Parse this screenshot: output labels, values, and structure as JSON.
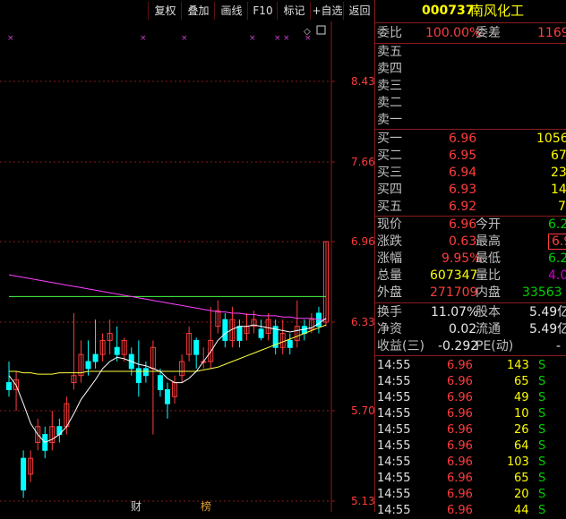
{
  "toolbar": {
    "buttons": [
      "复权",
      "叠加",
      "画线",
      "F10",
      "标记",
      "+自选",
      "返回"
    ]
  },
  "colors": {
    "up": "#ff3c3c",
    "down": "#00ffff",
    "ma_white": "#ffffff",
    "ma_yellow": "#ffff40",
    "ma_magenta": "#ff40ff",
    "ma_green": "#40ff40",
    "grid": "#8a1c1c",
    "price_label": "#ff3c3c"
  },
  "stock": {
    "code": "000737",
    "name": "南风化工"
  },
  "order_book": {
    "weibi_label": "委比",
    "weibi_value": "100.00%",
    "weicha_label": "委差",
    "weicha_value": "1169",
    "sell": [
      {
        "label": "卖五",
        "price": "",
        "vol": ""
      },
      {
        "label": "卖四",
        "price": "",
        "vol": ""
      },
      {
        "label": "卖三",
        "price": "",
        "vol": ""
      },
      {
        "label": "卖二",
        "price": "",
        "vol": ""
      },
      {
        "label": "卖一",
        "price": "",
        "vol": ""
      }
    ],
    "buy": [
      {
        "label": "买一",
        "price": "6.96",
        "vol": "1056"
      },
      {
        "label": "买二",
        "price": "6.95",
        "vol": "67"
      },
      {
        "label": "买三",
        "price": "6.94",
        "vol": "23"
      },
      {
        "label": "买四",
        "price": "6.93",
        "vol": "14"
      },
      {
        "label": "买五",
        "price": "6.92",
        "vol": "7"
      }
    ]
  },
  "quote": [
    {
      "l1": "现价",
      "v1": "6.96",
      "c1": "red",
      "l2": "今开",
      "v2": "6.2",
      "c2": "green",
      "box": false
    },
    {
      "l1": "涨跌",
      "v1": "0.63",
      "c1": "red",
      "l2": "最高",
      "v2": "6.9",
      "c2": "red",
      "box": true
    },
    {
      "l1": "涨幅",
      "v1": "9.95%",
      "c1": "red",
      "l2": "最低",
      "v2": "6.2",
      "c2": "green",
      "box": false
    },
    {
      "l1": "总量",
      "v1": "607347",
      "c1": "yellow",
      "l2": "量比",
      "v2": "4.0",
      "c2": "purple",
      "box": false
    },
    {
      "l1": "外盘",
      "v1": "271709",
      "c1": "red",
      "l2": "内盘",
      "v2": "33563",
      "c2": "green",
      "box": false
    }
  ],
  "stats": [
    {
      "l1": "换手",
      "v1": "11.07%",
      "l2": "股本",
      "v2": "5.49亿"
    },
    {
      "l1": "净资",
      "v1": "0.02",
      "l2": "流通",
      "v2": "5.49亿"
    },
    {
      "l1": "收益(三)",
      "v1": "-0.292",
      "l2": "PE(动)",
      "v2": "-"
    }
  ],
  "ticks": [
    {
      "time": "14:55",
      "price": "6.96",
      "vol": "143",
      "side": "S"
    },
    {
      "time": "14:55",
      "price": "6.96",
      "vol": "65",
      "side": "S"
    },
    {
      "time": "14:55",
      "price": "6.96",
      "vol": "49",
      "side": "S"
    },
    {
      "time": "14:55",
      "price": "6.96",
      "vol": "10",
      "side": "S"
    },
    {
      "time": "14:55",
      "price": "6.96",
      "vol": "26",
      "side": "S"
    },
    {
      "time": "14:55",
      "price": "6.96",
      "vol": "64",
      "side": "S"
    },
    {
      "time": "14:55",
      "price": "6.96",
      "vol": "103",
      "side": "S"
    },
    {
      "time": "14:55",
      "price": "6.96",
      "vol": "65",
      "side": "S"
    },
    {
      "time": "14:55",
      "price": "6.96",
      "vol": "20",
      "side": "S"
    },
    {
      "time": "14:55",
      "price": "6.96",
      "vol": "44",
      "side": "S"
    }
  ],
  "chart_data": {
    "type": "candlestick",
    "y_ticks": [
      "8.43",
      "7.66",
      "6.96",
      "6.33",
      "5.70",
      "5.13"
    ],
    "ylim": [
      5.1,
      8.95
    ],
    "markers_bottom": [
      "财",
      "榜"
    ],
    "candles": [
      [
        5.9,
        5.85,
        6.05,
        5.8
      ],
      [
        5.85,
        5.92,
        5.98,
        5.7
      ],
      [
        5.4,
        5.2,
        5.45,
        5.15
      ],
      [
        5.3,
        5.4,
        5.45,
        5.25
      ],
      [
        5.5,
        5.6,
        5.65,
        5.45
      ],
      [
        5.55,
        5.45,
        5.6,
        5.4
      ],
      [
        5.5,
        5.6,
        5.7,
        5.45
      ],
      [
        5.6,
        5.55,
        5.65,
        5.5
      ],
      [
        5.6,
        5.75,
        5.8,
        5.55
      ],
      [
        5.9,
        5.95,
        6.4,
        5.85
      ],
      [
        5.95,
        6.1,
        6.2,
        5.9
      ],
      [
        6.05,
        6.0,
        6.2,
        5.95
      ],
      [
        6.1,
        6.05,
        6.35,
        6.0
      ],
      [
        6.1,
        6.2,
        6.25,
        6.05
      ],
      [
        6.2,
        6.25,
        6.35,
        6.1
      ],
      [
        6.15,
        6.1,
        6.3,
        6.05
      ],
      [
        6.1,
        6.2,
        6.22,
        6.05
      ],
      [
        6.1,
        6.0,
        6.15,
        5.95
      ],
      [
        6.0,
        5.9,
        6.2,
        5.8
      ],
      [
        6.0,
        5.95,
        6.05,
        5.9
      ],
      [
        6.0,
        6.15,
        6.2,
        5.55
      ],
      [
        5.95,
        5.85,
        6.0,
        5.8
      ],
      [
        5.85,
        5.75,
        5.9,
        5.65
      ],
      [
        5.8,
        5.9,
        5.95,
        5.75
      ],
      [
        5.95,
        6.05,
        6.1,
        5.9
      ],
      [
        6.1,
        6.25,
        6.3,
        6.05
      ],
      [
        6.2,
        6.1,
        6.22,
        6.0
      ],
      [
        6.05,
        6.05,
        6.15,
        6.0
      ],
      [
        6.05,
        6.2,
        6.45,
        6.0
      ],
      [
        6.3,
        6.42,
        6.5,
        6.25
      ],
      [
        6.35,
        6.2,
        6.4,
        6.15
      ],
      [
        6.2,
        6.35,
        6.45,
        6.15
      ],
      [
        6.3,
        6.2,
        6.35,
        6.15
      ],
      [
        6.25,
        6.3,
        6.4,
        6.2
      ],
      [
        6.3,
        6.35,
        6.42,
        6.25
      ],
      [
        6.28,
        6.22,
        6.35,
        6.2
      ],
      [
        6.25,
        6.35,
        6.4,
        6.2
      ],
      [
        6.3,
        6.15,
        6.35,
        6.1
      ],
      [
        6.15,
        6.25,
        6.35,
        6.1
      ],
      [
        6.2,
        6.15,
        6.25,
        6.1
      ],
      [
        6.2,
        6.3,
        6.5,
        6.15
      ],
      [
        6.3,
        6.25,
        6.35,
        6.2
      ],
      [
        6.28,
        6.35,
        6.4,
        6.25
      ],
      [
        6.4,
        6.3,
        6.45,
        6.25
      ],
      [
        6.33,
        6.96,
        6.96,
        6.3
      ]
    ],
    "ma_white": [
      5.95,
      5.88,
      5.75,
      5.62,
      5.55,
      5.5,
      5.52,
      5.55,
      5.6,
      5.68,
      5.78,
      5.85,
      5.92,
      6.0,
      6.05,
      6.08,
      6.07,
      6.05,
      6.03,
      6.02,
      6.0,
      5.98,
      5.93,
      5.9,
      5.9,
      5.93,
      5.98,
      6.05,
      6.12,
      6.2,
      6.25,
      6.28,
      6.3,
      6.3,
      6.31,
      6.3,
      6.29,
      6.28,
      6.27,
      6.26,
      6.27,
      6.28,
      6.29,
      6.32,
      6.36
    ],
    "ma_yellow": [
      5.98,
      5.98,
      5.97,
      5.97,
      5.96,
      5.96,
      5.96,
      5.97,
      5.97,
      5.97,
      5.97,
      5.98,
      5.98,
      5.98,
      5.98,
      5.98,
      5.98,
      5.98,
      5.98,
      5.98,
      5.98,
      5.98,
      5.98,
      5.98,
      5.98,
      5.98,
      5.98,
      5.99,
      6.0,
      6.01,
      6.03,
      6.05,
      6.07,
      6.09,
      6.11,
      6.13,
      6.15,
      6.17,
      6.19,
      6.21,
      6.23,
      6.25,
      6.27,
      6.29,
      6.31
    ],
    "ma_magenta": [
      6.7,
      6.69,
      6.68,
      6.67,
      6.66,
      6.65,
      6.64,
      6.63,
      6.62,
      6.61,
      6.6,
      6.59,
      6.58,
      6.57,
      6.56,
      6.55,
      6.54,
      6.53,
      6.52,
      6.51,
      6.5,
      6.49,
      6.48,
      6.47,
      6.46,
      6.45,
      6.44,
      6.43,
      6.42,
      6.41,
      6.41,
      6.4,
      6.4,
      6.39,
      6.39,
      6.38,
      6.38,
      6.38,
      6.37,
      6.37,
      6.36,
      6.36,
      6.36,
      6.35,
      6.35
    ],
    "ma_green": [
      6.53,
      6.53,
      6.53,
      6.53,
      6.53,
      6.53,
      6.53,
      6.53,
      6.53,
      6.53,
      6.53,
      6.53,
      6.53,
      6.53,
      6.53,
      6.53,
      6.53,
      6.53,
      6.53,
      6.53,
      6.53,
      6.53,
      6.53,
      6.53,
      6.53,
      6.53,
      6.53,
      6.53,
      6.53,
      6.53,
      6.53,
      6.53,
      6.53,
      6.53,
      6.53,
      6.53,
      6.53,
      6.53,
      6.53,
      6.53,
      6.53,
      6.53,
      6.53,
      6.53,
      6.53
    ]
  }
}
